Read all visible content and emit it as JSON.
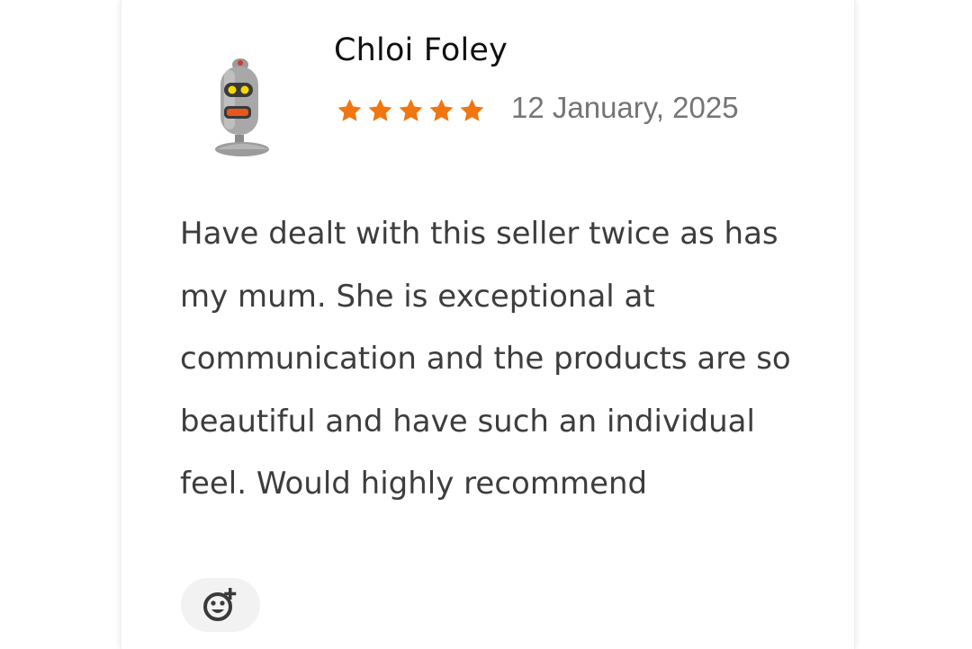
{
  "review": {
    "reviewer_name": "Chloi Foley",
    "rating": 5,
    "rating_max": 5,
    "date": "12 January, 2025",
    "text": "Have dealt with this seller twice as has my mum. She is exceptional at communication and the products are so beautiful and have such an individual feel. Would highly recommend"
  },
  "icons": {
    "avatar": "robot-avatar-icon",
    "star": "star-icon",
    "reaction": "add-reaction-icon"
  },
  "colors": {
    "star": "#f1760f",
    "date": "#757575",
    "text": "#3d3d3d",
    "reaction_bg": "#f2f2f2"
  }
}
